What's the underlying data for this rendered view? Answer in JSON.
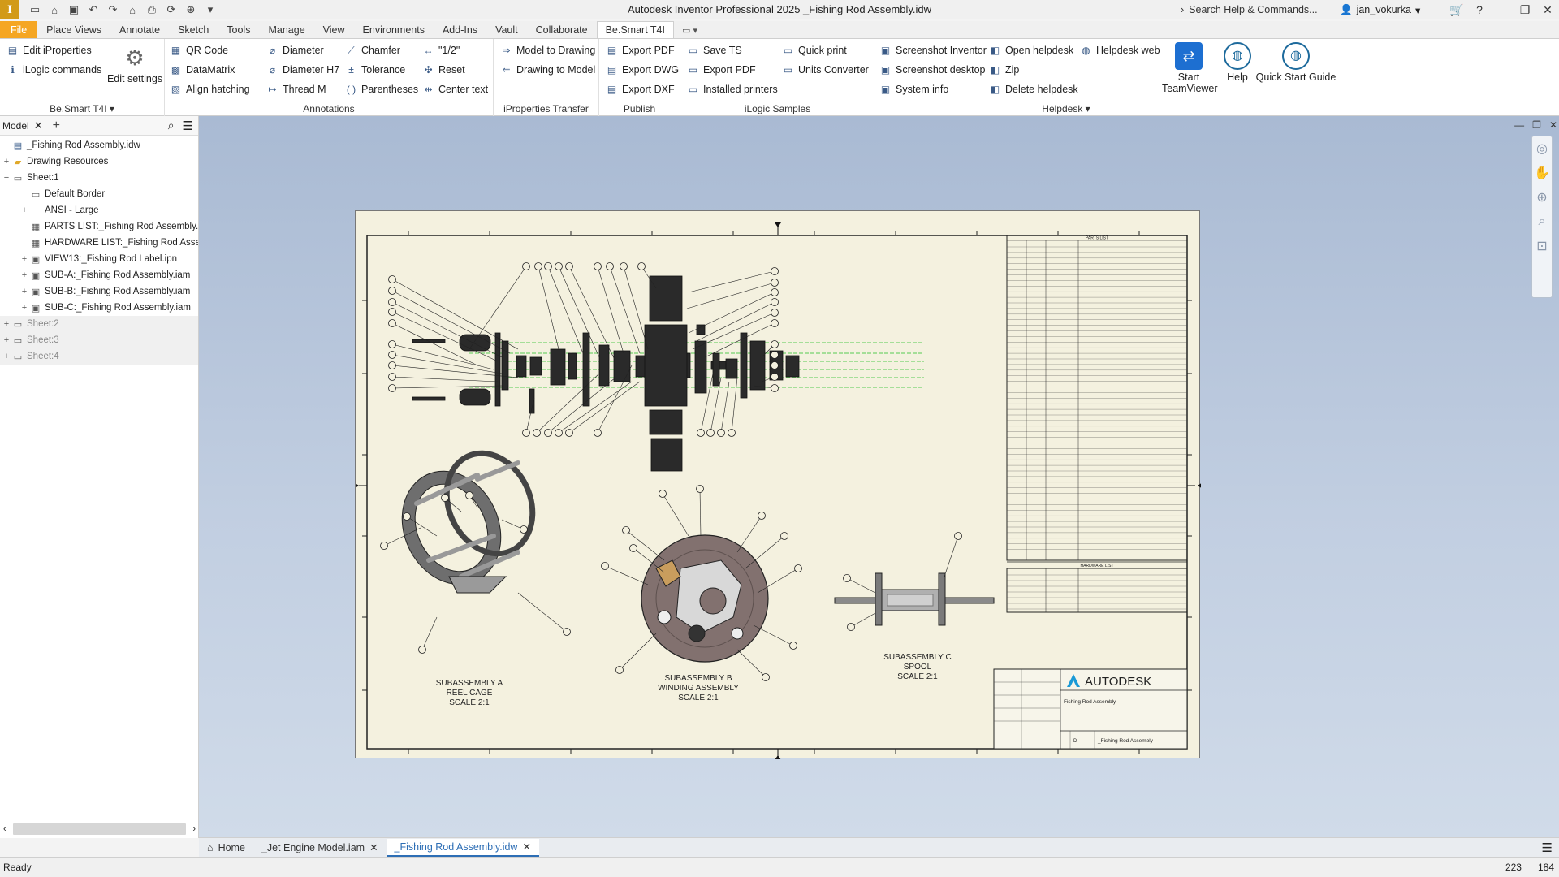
{
  "titlebar": {
    "app_logo": "I",
    "title": "Autodesk Inventor Professional 2025   _Fishing Rod Assembly.idw",
    "search": "Search Help & Commands...",
    "user": "jan_vokurka",
    "qat_icons": [
      "new-icon",
      "open-icon",
      "save-icon",
      "undo-icon",
      "redo-icon",
      "home-icon",
      "print-icon"
    ]
  },
  "menu": {
    "tabs": [
      "File",
      "Place Views",
      "Annotate",
      "Sketch",
      "Tools",
      "Manage",
      "View",
      "Environments",
      "Add-Ins",
      "Vault",
      "Collaborate",
      "Be.Smart T4I"
    ],
    "active": "Be.Smart T4I"
  },
  "ribbon": {
    "panel1": {
      "title": "Be.Smart T4I",
      "edit_iproperties": "Edit iProperties",
      "ilogic_commands": "iLogic commands",
      "edit_settings": "Edit settings"
    },
    "panel2": {
      "qr_code": "QR Code",
      "datamatrix": "DataMatrix",
      "align_hatching": "Align hatching",
      "diameter": "Diameter",
      "diameter_h7": "Diameter H7",
      "thread_m": "Thread M",
      "chamfer": "Chamfer",
      "tolerance": "Tolerance",
      "parentheses": "Parentheses",
      "half": "\"1/2\"",
      "reset": "Reset",
      "center_text": "Center text",
      "title": "Annotations"
    },
    "panel3": {
      "title": "iProperties Transfer",
      "model_to_drawing": "Model to Drawing",
      "drawing_to_model": "Drawing to Model"
    },
    "panel4": {
      "title": "Publish",
      "export_pdf": "Export PDF",
      "export_dwg": "Export DWG",
      "export_dxf": "Export DXF"
    },
    "panel5": {
      "title": "iLogic Samples",
      "save_ts": "Save TS",
      "export_pdf": "Export PDF",
      "installed_printers": "Installed printers",
      "quick_print": "Quick print",
      "units_converter": "Units Converter"
    },
    "panel6": {
      "title": "Helpdesk",
      "screenshot_inventor": "Screenshot Inventor",
      "screenshot_desktop": "Screenshot desktop",
      "system_info": "System info",
      "open_helpdesk": "Open helpdesk",
      "zip": "Zip",
      "delete_helpdesk": "Delete helpdesk",
      "helpdesk_web": "Helpdesk web"
    },
    "big": {
      "teamviewer": "Start TeamViewer",
      "help": "Help",
      "quick_start": "Quick Start Guide"
    }
  },
  "browser": {
    "tab": "Model",
    "tree": [
      {
        "label": "_Fishing Rod Assembly.idw",
        "level": 0,
        "exp": "",
        "icon": "drawing-icon"
      },
      {
        "label": "Drawing Resources",
        "level": 0,
        "exp": "+",
        "icon": "folder-icon"
      },
      {
        "label": "Sheet:1",
        "level": 0,
        "exp": "−",
        "icon": "sheet-icon"
      },
      {
        "label": "Default Border",
        "level": 1,
        "exp": "",
        "icon": "border-icon"
      },
      {
        "label": "ANSI - Large",
        "level": 1,
        "exp": "+",
        "icon": "titleblock-icon"
      },
      {
        "label": "PARTS LIST:_Fishing Rod Assembly.iam",
        "level": 1,
        "exp": "",
        "icon": "table-icon"
      },
      {
        "label": "HARDWARE LIST:_Fishing Rod Assembly",
        "level": 1,
        "exp": "",
        "icon": "table-icon"
      },
      {
        "label": "VIEW13:_Fishing Rod Label.ipn",
        "level": 1,
        "exp": "+",
        "icon": "view-icon"
      },
      {
        "label": "SUB-A:_Fishing Rod Assembly.iam",
        "level": 1,
        "exp": "+",
        "icon": "view-icon"
      },
      {
        "label": "SUB-B:_Fishing Rod Assembly.iam",
        "level": 1,
        "exp": "+",
        "icon": "view-icon"
      },
      {
        "label": "SUB-C:_Fishing Rod Assembly.iam",
        "level": 1,
        "exp": "+",
        "icon": "view-icon"
      },
      {
        "label": "Sheet:2",
        "level": 0,
        "exp": "+",
        "icon": "sheet-icon",
        "dim": true
      },
      {
        "label": "Sheet:3",
        "level": 0,
        "exp": "+",
        "icon": "sheet-icon",
        "dim": true
      },
      {
        "label": "Sheet:4",
        "level": 0,
        "exp": "+",
        "icon": "sheet-icon",
        "dim": true
      }
    ]
  },
  "drawing": {
    "sub_a": [
      "SUBASSEMBLY A",
      "REEL CAGE",
      "SCALE 2:1"
    ],
    "sub_b": [
      "SUBASSEMBLY B",
      "WINDING ASSEMBLY",
      "SCALE 2:1"
    ],
    "sub_c": [
      "SUBASSEMBLY C",
      "SPOOL",
      "SCALE 2:1"
    ],
    "titleblock": {
      "brand": "AUTODESK",
      "title": "Fishing Rod Assembly",
      "dwg_name": "_Fishing Rod Assembly",
      "size": "D"
    },
    "parts_list_title": "PARTS LIST",
    "hardware_list_title": "HARDWARE LIST"
  },
  "doctabs": {
    "home": "Home",
    "tabs": [
      "_Jet Engine Model.iam",
      "_Fishing Rod Assembly.idw"
    ],
    "active": 1
  },
  "status": {
    "text": "Ready",
    "n1": "223",
    "n2": "184"
  },
  "colors": {
    "accent": "#f5a623",
    "canvas_top": "#a9bad3",
    "paper": "#f4f1df",
    "active_tab": "#2d6eb5"
  }
}
